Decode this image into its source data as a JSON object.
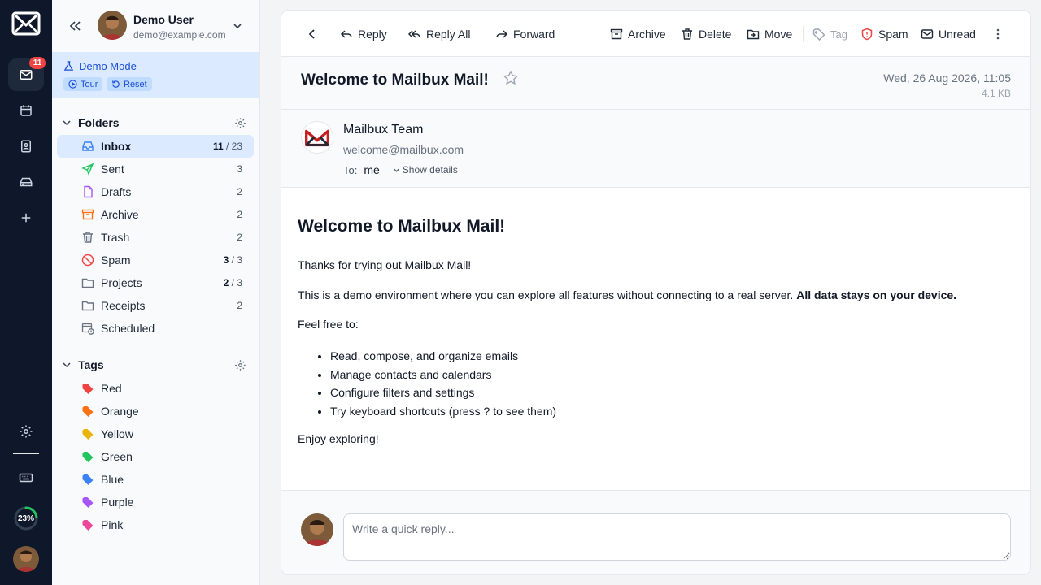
{
  "rail": {
    "mail_badge": "11",
    "quota_percent": "23%",
    "quota_fraction": 0.23
  },
  "account": {
    "name": "Demo User",
    "email": "demo@example.com"
  },
  "demo": {
    "label": "Demo Mode",
    "tour_label": "Tour",
    "reset_label": "Reset"
  },
  "folders": {
    "title": "Folders",
    "items": [
      {
        "label": "Inbox",
        "count_bold": "11",
        "count_rest": " / 23",
        "icon": "inbox-icon"
      },
      {
        "label": "Sent",
        "count_bold": "",
        "count_rest": "3",
        "icon": "send-icon"
      },
      {
        "label": "Drafts",
        "count_bold": "",
        "count_rest": "2",
        "icon": "file-icon"
      },
      {
        "label": "Archive",
        "count_bold": "",
        "count_rest": "2",
        "icon": "archive-icon"
      },
      {
        "label": "Trash",
        "count_bold": "",
        "count_rest": "2",
        "icon": "trash-icon"
      },
      {
        "label": "Spam",
        "count_bold": "3",
        "count_rest": " / 3",
        "icon": "ban-icon"
      },
      {
        "label": "Projects",
        "count_bold": "2",
        "count_rest": " / 3",
        "icon": "folder-icon"
      },
      {
        "label": "Receipts",
        "count_bold": "",
        "count_rest": "2",
        "icon": "folder-icon"
      },
      {
        "label": "Scheduled",
        "count_bold": "",
        "count_rest": "",
        "icon": "calendar-clock-icon"
      }
    ]
  },
  "tags": {
    "title": "Tags",
    "items": [
      {
        "label": "Red",
        "color": "#ef4444"
      },
      {
        "label": "Orange",
        "color": "#f97316"
      },
      {
        "label": "Yellow",
        "color": "#eab308"
      },
      {
        "label": "Green",
        "color": "#22c55e"
      },
      {
        "label": "Blue",
        "color": "#3b82f6"
      },
      {
        "label": "Purple",
        "color": "#a855f7"
      },
      {
        "label": "Pink",
        "color": "#ec4899"
      }
    ]
  },
  "toolbar": {
    "reply": "Reply",
    "reply_all": "Reply All",
    "forward": "Forward",
    "archive": "Archive",
    "delete": "Delete",
    "move": "Move",
    "tag": "Tag",
    "spam": "Spam",
    "unread": "Unread"
  },
  "message": {
    "subject": "Welcome to Mailbux Mail!",
    "date": "Wed, 26 Aug 2026, 11:05",
    "size": "4.1 KB",
    "sender_name": "Mailbux Team",
    "sender_email": "welcome@mailbux.com",
    "to_label": "To:",
    "to_value": "me",
    "show_details": "Show details",
    "body": {
      "heading": "Welcome to Mailbux Mail!",
      "p1": "Thanks for trying out Mailbux Mail!",
      "p2": "This is a demo environment where you can explore all features without connecting to a real server. ",
      "p2_bold": "All data stays on your device.",
      "p3": "Feel free to:",
      "bullets": [
        "Read, compose, and organize emails",
        "Manage contacts and calendars",
        "Configure filters and settings",
        "Try keyboard shortcuts (press ? to see them)"
      ],
      "p4": "Enjoy exploring!"
    }
  },
  "quick_reply": {
    "placeholder": "Write a quick reply..."
  },
  "colors": {
    "accent": "#1d4ed8",
    "rail_bg": "#0f172a",
    "badge": "#ef4444",
    "logo_red": "#c81e1e"
  }
}
